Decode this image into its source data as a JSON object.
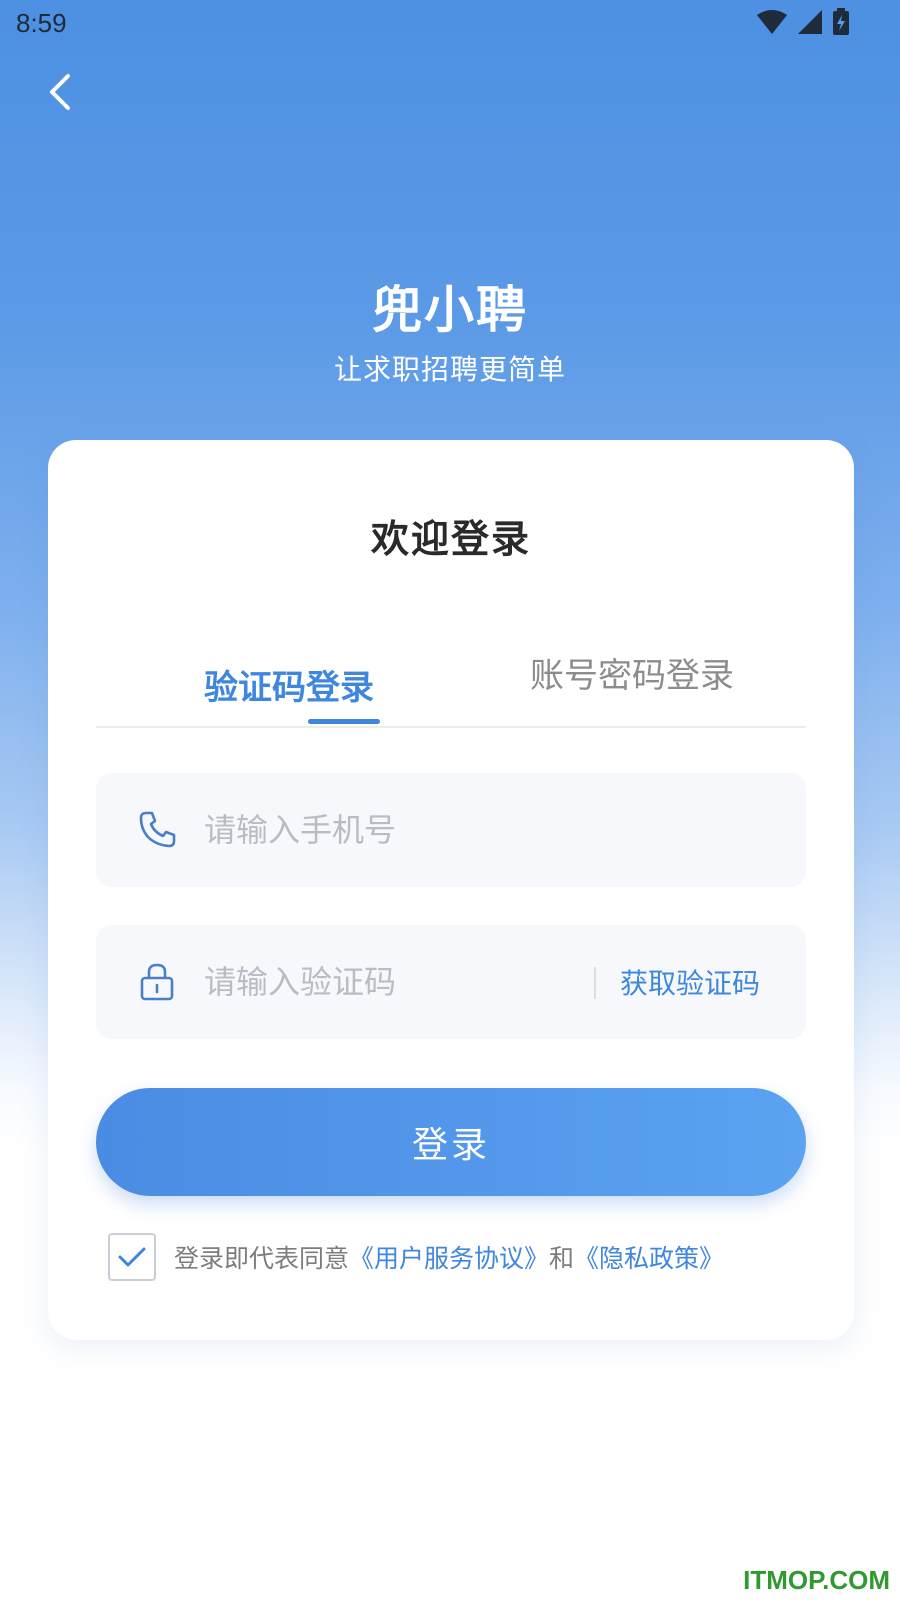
{
  "status_bar": {
    "time": "8:59"
  },
  "header": {
    "back_icon": "chevron-left-icon",
    "app_name": "兜小聘",
    "slogan": "让求职招聘更简单"
  },
  "login_card": {
    "welcome": "欢迎登录",
    "tabs": [
      {
        "label": "验证码登录",
        "active": true
      },
      {
        "label": "账号密码登录",
        "active": false
      }
    ],
    "phone_field": {
      "placeholder": "请输入手机号",
      "value": "",
      "icon": "phone-icon"
    },
    "code_field": {
      "placeholder": "请输入验证码",
      "value": "",
      "icon": "lock-icon",
      "get_code_label": "获取验证码"
    },
    "login_button": "登录",
    "agreement": {
      "checked": true,
      "prefix": "登录即代表同意",
      "terms_link": "《用户服务协议》",
      "conjunction": "和",
      "privacy_link": "《隐私政策》"
    }
  },
  "watermark": "ITMOP.COM",
  "colors": {
    "accent": "#3f86df",
    "header_gradient_top": "#4d90e2",
    "watermark": "#2f9a2f"
  }
}
